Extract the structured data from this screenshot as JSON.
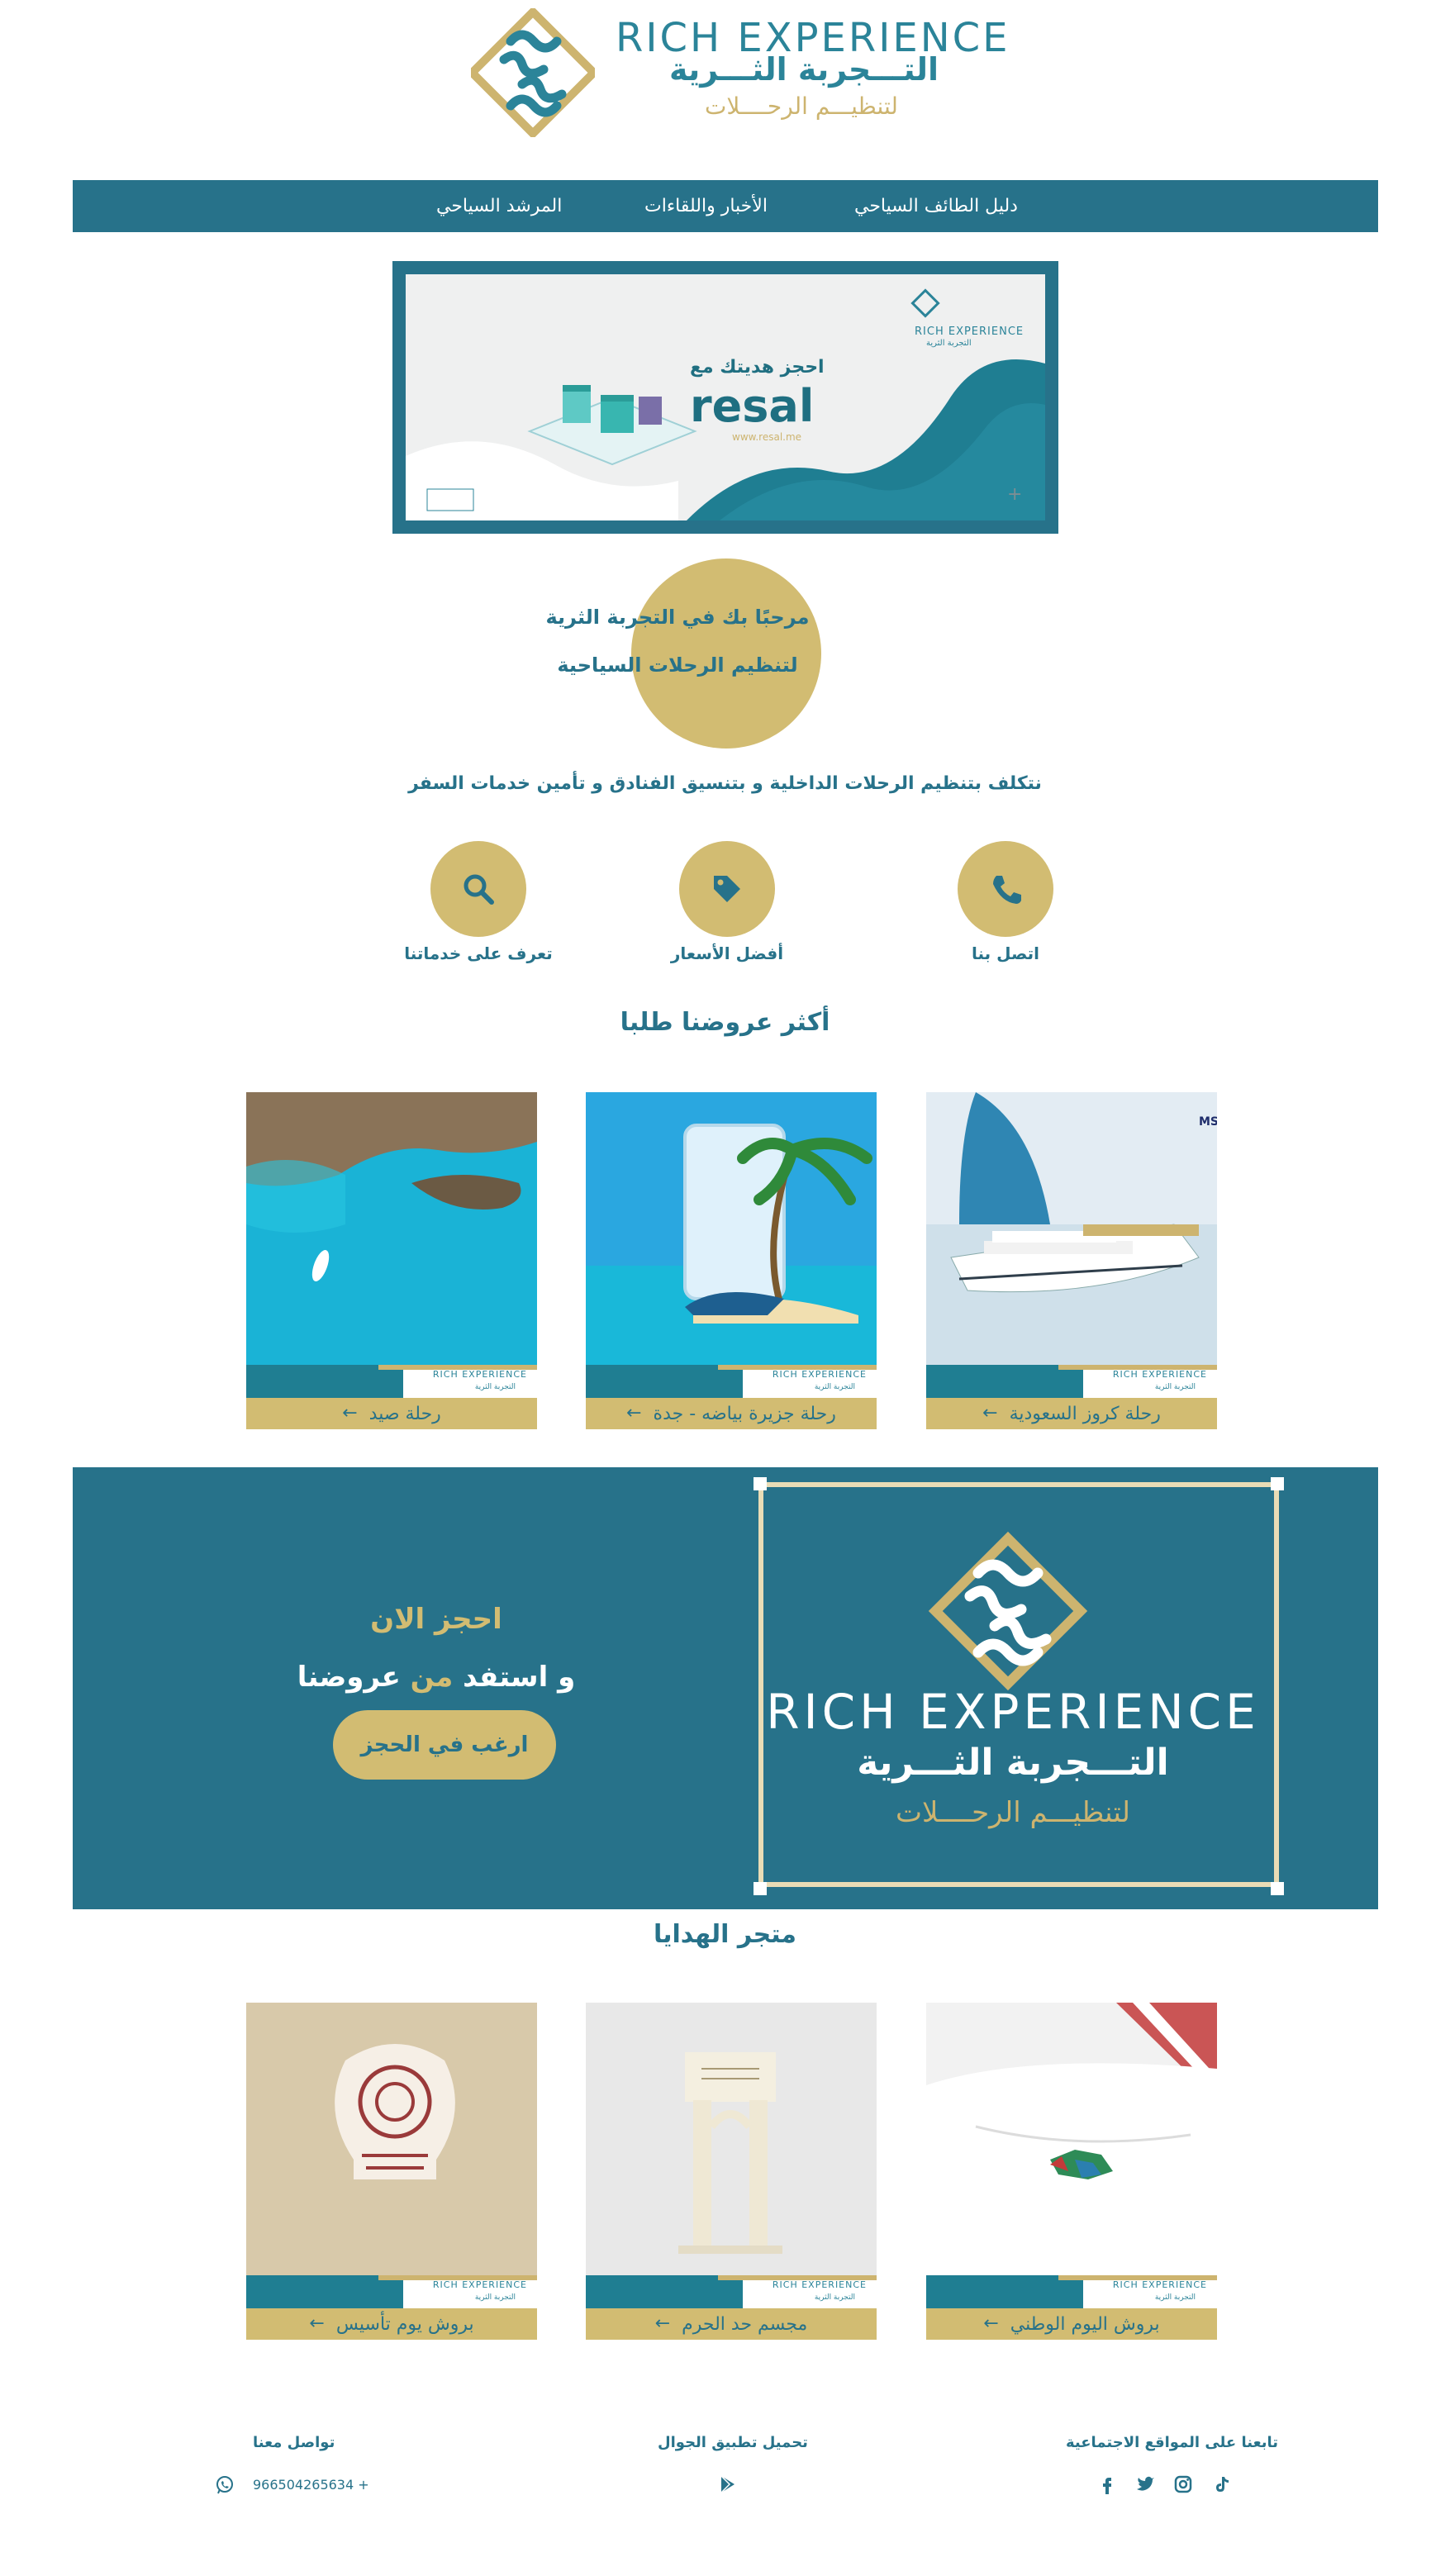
{
  "brand": {
    "name_en": "RICH EXPERIENCE",
    "name_ar": "التـــجربة الثـــرية",
    "subtitle_ar": "لتنظيـــم الرحــــلات"
  },
  "nav": {
    "items": [
      {
        "label": "دليل الطائف السياحي"
      },
      {
        "label": "الأخبار واللقاءات"
      },
      {
        "label": "المرشد السياحي"
      }
    ]
  },
  "banner": {
    "cta": "احجز هديتك مع",
    "brand": "resal",
    "url": "www.resal.me",
    "mini_en": "RICH EXPERIENCE",
    "mini_ar": "التجربة الثرية"
  },
  "welcome": {
    "line1": "مرحبًا بك في التجربة الثرية",
    "line2": "لتنظيم الرحلات السياحية",
    "tagline": "نتكلف بتنظيم الرحلات الداخلية و بتنسيق الفنادق و تأمين خدمات السفر"
  },
  "features": [
    {
      "label": "اتصل بنا",
      "icon": "phone-icon"
    },
    {
      "label": "أفضل الأسعار",
      "icon": "tag-icon"
    },
    {
      "label": "تعرف على خدماتنا",
      "icon": "search-icon"
    }
  ],
  "offers": {
    "title": "أكثر عروضنا طلبا",
    "items": [
      {
        "label": "رحلة كروز السعودية"
      },
      {
        "label": "رحلة جزيرة بياضه - جدة"
      },
      {
        "label": "رحلة صيد"
      }
    ]
  },
  "book": {
    "heading": "احجز الان",
    "sub_prefix": "و استفد ",
    "sub_accent": "من",
    "sub_suffix": " عروضنا",
    "button": "ارغب في الحجز"
  },
  "gifts": {
    "title": "متجر الهدايا",
    "items": [
      {
        "label": "بروش اليوم الوطني"
      },
      {
        "label": "مجسم حد الحرم"
      },
      {
        "label": "بروش يوم تأسيس"
      }
    ]
  },
  "card_strip": {
    "en": "RICH EXPERIENCE",
    "ar": "التجربة الثرية"
  },
  "footer": {
    "social_title": "تابعنا على المواقع الاجتماعية",
    "app_title": "تحميل تطبيق الجوال",
    "contact_title": "تواصل معنا",
    "phone": "966504265634 +"
  },
  "colors": {
    "primary": "#27728a",
    "gold": "#d2bc72"
  }
}
